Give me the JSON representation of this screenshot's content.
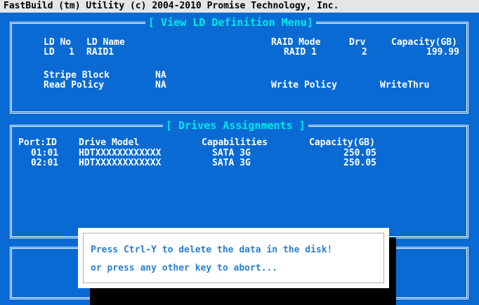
{
  "title_bar": "FastBuild (tm) Utility (c) 2004-2010 Promise Technology, Inc.",
  "view_ld_menu": {
    "title": "[ View LD Definition Menu]",
    "headers": {
      "ld_no": "LD No",
      "ld_name": "LD Name",
      "raid_mode": "RAID Mode",
      "drv": "Drv",
      "capacity": "Capacity(GB)"
    },
    "row": {
      "ld": "LD",
      "no": "1",
      "name": "RAID1",
      "raid_mode": "RAID 1",
      "drv": "2",
      "capacity": "199.99"
    },
    "stripe_block_label": "Stripe Block",
    "stripe_block_value": "NA",
    "read_policy_label": "Read Policy",
    "read_policy_value": "NA",
    "write_policy_label": "Write Policy",
    "write_policy_value": "WriteThru"
  },
  "drives_assignments": {
    "title": "[ Drives Assignments ]",
    "headers": {
      "port_id": "Port:ID",
      "drive_model": "Drive Model",
      "capabilities": "Capabilities",
      "capacity": "Capacity(GB)"
    },
    "rows": [
      {
        "port_id": "01:01",
        "model": "HDTXXXXXXXXXXXX",
        "capabilities": "SATA 3G",
        "capacity": "250.05"
      },
      {
        "port_id": "02:01",
        "model": "HDTXXXXXXXXXXXX",
        "capabilities": "SATA 3G",
        "capacity": "250.05"
      }
    ]
  },
  "dialog": {
    "line1": "Press Ctrl-Y to delete the data in the disk!",
    "line2": "or press any other key to abort..."
  },
  "colors": {
    "background": "#0a6ad4",
    "title_text": "#00e8e8",
    "dialog_text": "#2a7fd0"
  }
}
